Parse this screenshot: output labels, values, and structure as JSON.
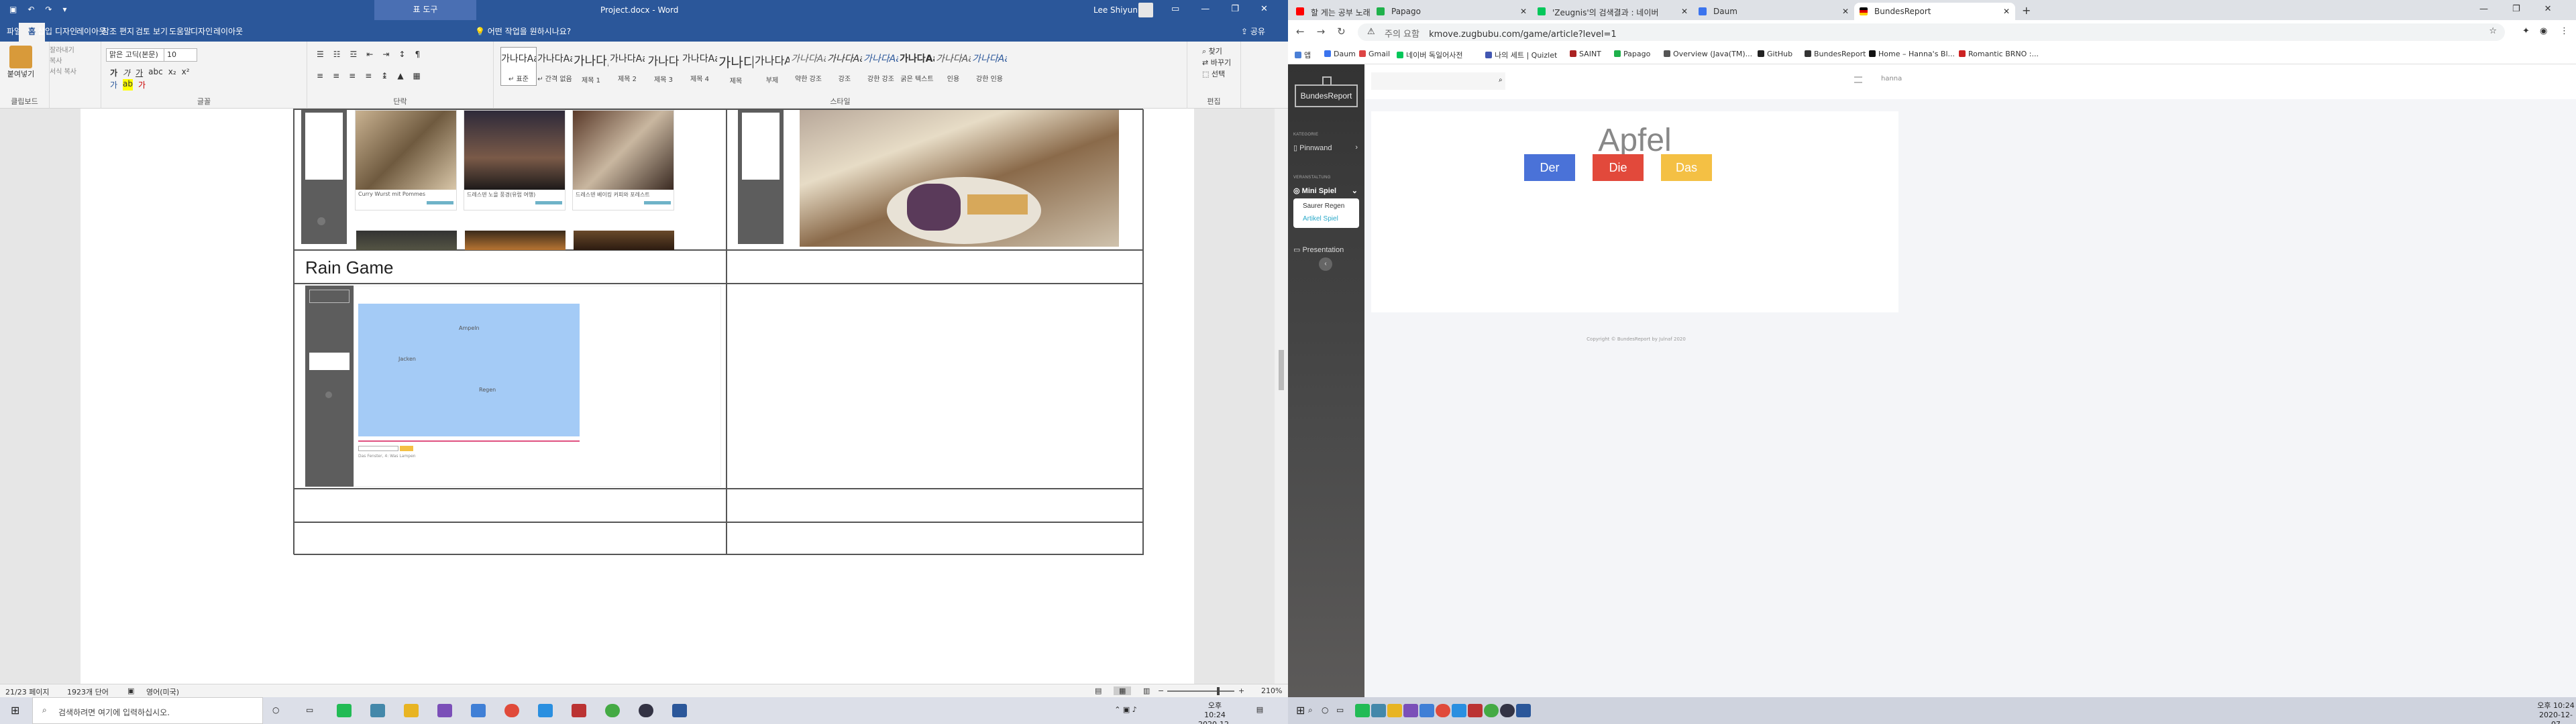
{
  "word": {
    "title": "Project.docx - Word",
    "context_tab_group": "표 도구",
    "user": "Lee Shiyun",
    "quick_access": [
      "↶",
      "↷"
    ],
    "tabs": [
      "파일",
      "홈",
      "삽입",
      "디자인",
      "레이아웃",
      "참조",
      "편지",
      "검토",
      "보기",
      "도움말",
      "디자인",
      "레이아웃"
    ],
    "active_tab": "홈",
    "tell_me": "어떤 작업을 원하시나요?",
    "share": "공유",
    "clipboard": {
      "paste": "붙여넣기",
      "cut": "잘라내기",
      "copy": "복사",
      "format_painter": "서식 복사",
      "label": "클립보드"
    },
    "font": {
      "name": "맑은 고딕(본문)",
      "size": "10",
      "label": "글꼴"
    },
    "paragraph_label": "단락",
    "styles_label": "스타일",
    "editing_label": "편집",
    "styles": [
      {
        "preview": "가나다AaE",
        "name": "↵ 표준"
      },
      {
        "preview": "가나다AaE",
        "name": "↵ 간격 없음"
      },
      {
        "preview": "가나다,",
        "name": "제목 1"
      },
      {
        "preview": "가나다AaE",
        "name": "제목 2"
      },
      {
        "preview": "가나다",
        "name": "제목 3"
      },
      {
        "preview": "가나다AaE",
        "name": "제목 4"
      },
      {
        "preview": "가나디",
        "name": "제목"
      },
      {
        "preview": "가나다A",
        "name": "부제"
      },
      {
        "preview": "가나다Aa",
        "name": "약한 강조"
      },
      {
        "preview": "가나다Aa",
        "name": "강조"
      },
      {
        "preview": "가나다Aa",
        "name": "강한 강조"
      },
      {
        "preview": "가나다AaE",
        "name": "굵은 텍스트"
      },
      {
        "preview": "가나다AaE",
        "name": "인용"
      },
      {
        "preview": "가나다AaE",
        "name": "강한 인용"
      }
    ],
    "editing": [
      "찾기",
      "바꾸기",
      "선택"
    ],
    "document": {
      "section_title": "Rain Game",
      "thumb1_caption": "Curry Wurst mit Pommes",
      "thumb2_caption": "드레스덴 노을 풍경(유럽 여행)",
      "thumb3_caption": "드레스덴 베이킹 커피와 포레스트",
      "game_word_1": "Ampeln",
      "game_word_2": "Jacken",
      "game_word_3": "Regen",
      "game_score": "Das Fenster, 4: Was Lampen"
    },
    "status": {
      "page": "21/23 페이지",
      "words": "1923개 단어",
      "lang": "영어(미국)",
      "zoom": "210%"
    }
  },
  "chrome": {
    "tabs": [
      {
        "title": "할 게는 공부 노래 모음 ||",
        "color": "#ff0000"
      },
      {
        "title": "Papago",
        "color": "#1fb14b"
      },
      {
        "title": "'Zeugnis'의 검색결과 : 네이버",
        "color": "#03c75a"
      },
      {
        "title": "Daum",
        "color": "#3b74ee"
      },
      {
        "title": "BundesReport",
        "color": "#d00000"
      }
    ],
    "active_tab": 4,
    "url_scheme": "주의 요함",
    "url": "kmove.zugbubu.com/game/article?level=1",
    "bookmarks": [
      "앱",
      "Daum",
      "Gmail",
      "네이버 독일어사전",
      "나의 세트 | Quizlet",
      "SAINT",
      "Papago",
      "Overview (Java(TM)...",
      "GitHub",
      "BundesReport",
      "Home – Hanna's Bl...",
      "Romantic BRNO :..."
    ]
  },
  "site": {
    "brand": "BundesReport",
    "categories_heading": "KATEGORIE",
    "pinnwand": "Pinnwand",
    "veranstaltung_heading": "VERANSTALTUNG",
    "mini_spiel": "Mini Spiel",
    "submenu": [
      "Saurer Regen",
      "Artikel Spiel"
    ],
    "presentation": "Presentation",
    "user": "hanna",
    "word": "Apfel",
    "articles": [
      {
        "label": "Der",
        "color": "#4a72d8"
      },
      {
        "label": "Die",
        "color": "#e2493b"
      },
      {
        "label": "Das",
        "color": "#f4c044"
      }
    ],
    "copyright": "Copyright © BundesReport by Julnaf 2020"
  },
  "taskbar": {
    "search_placeholder": "검색하려면 여기에 입력하십시오.",
    "time": "오후 10:24",
    "date": "2020-12-07",
    "lang": "A"
  }
}
